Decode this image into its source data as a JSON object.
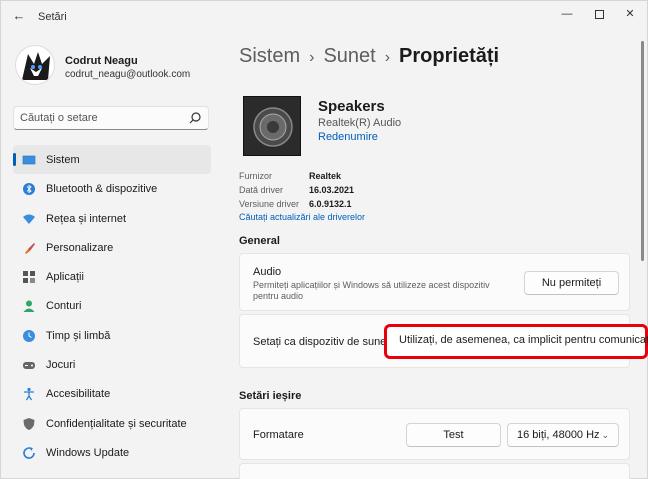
{
  "window": {
    "title": "Setări",
    "back_glyph": "←",
    "minimize_glyph": "—",
    "close_glyph": "✕"
  },
  "profile": {
    "name": "Codrut Neagu",
    "email": "codrut_neagu@outlook.com"
  },
  "search": {
    "placeholder": "Căutați o setare",
    "icon": "search-icon"
  },
  "sidebar": {
    "items": [
      {
        "label": "Sistem",
        "icon": "monitor-icon",
        "active": true
      },
      {
        "label": "Bluetooth & dispozitive",
        "icon": "bluetooth-icon",
        "active": false
      },
      {
        "label": "Rețea și internet",
        "icon": "wifi-icon",
        "active": false
      },
      {
        "label": "Personalizare",
        "icon": "paintbrush-icon",
        "active": false
      },
      {
        "label": "Aplicații",
        "icon": "apps-icon",
        "active": false
      },
      {
        "label": "Conturi",
        "icon": "person-icon",
        "active": false
      },
      {
        "label": "Timp și limbă",
        "icon": "clock-globe-icon",
        "active": false
      },
      {
        "label": "Jocuri",
        "icon": "gamepad-icon",
        "active": false
      },
      {
        "label": "Accesibilitate",
        "icon": "accessibility-icon",
        "active": false
      },
      {
        "label": "Confidențialitate și securitate",
        "icon": "shield-icon",
        "active": false
      },
      {
        "label": "Windows Update",
        "icon": "update-icon",
        "active": false
      }
    ]
  },
  "breadcrumb": {
    "items": [
      "Sistem",
      "Sunet"
    ],
    "current": "Proprietăți",
    "separator": "›"
  },
  "device": {
    "name": "Speakers",
    "driver": "Realtek(R) Audio",
    "rename_label": "Redenumire"
  },
  "driver_info": {
    "rows": [
      {
        "key": "Furnizor",
        "value": "Realtek"
      },
      {
        "key": "Dată driver",
        "value": "16.03.2021"
      },
      {
        "key": "Versiune driver",
        "value": "6.0.9132.1"
      }
    ],
    "update_link": "Căutați actualizări ale driverelor"
  },
  "general": {
    "title": "General",
    "audio_card": {
      "title": "Audio",
      "description": "Permiteți aplicațiilor și Windows să utilizeze acest dispozitiv pentru audio",
      "button_label": "Nu permiteți"
    },
    "default_card": {
      "title": "Setați ca dispozitiv de sunet implicit",
      "dropdown_label": "Utilizați, de asemenea, ca implicit pentru comunicații"
    }
  },
  "output": {
    "title": "Setări ieșire",
    "format_card": {
      "title": "Formatare",
      "test_button": "Test",
      "format_value": "16 biți, 48000 Hz",
      "chevron": "⌄"
    }
  },
  "colors": {
    "accent": "#005fb8",
    "highlight": "#e8000b"
  }
}
